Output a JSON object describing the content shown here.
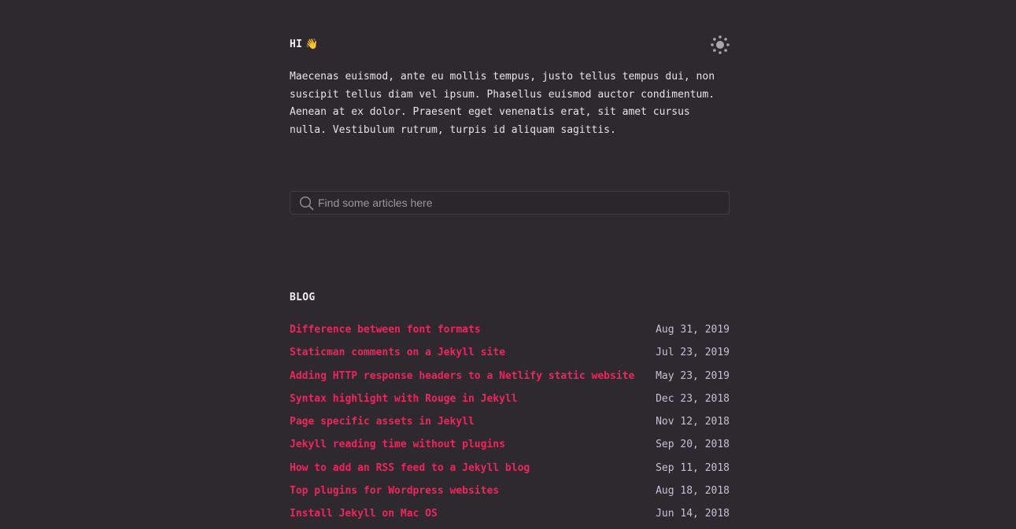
{
  "header": {
    "greeting": "HI",
    "wave_emoji": "👋",
    "theme_toggle_icon": "sun-icon"
  },
  "intro": {
    "text": "Maecenas euismod, ante eu mollis tempus, justo tellus tempus dui, non suscipit tellus diam vel ipsum. Phasellus euismod auctor condimentum. Aenean at ex dolor. Praesent eget venenatis erat, sit amet cursus nulla. Vestibulum rutrum, turpis id aliquam sagittis."
  },
  "search": {
    "placeholder": "Find some articles here",
    "value": "",
    "icon": "search-icon"
  },
  "blog": {
    "title": "BLOG",
    "posts": [
      {
        "title": "Difference between font formats",
        "date": "Aug 31, 2019"
      },
      {
        "title": "Staticman comments on a Jekyll site",
        "date": "Jul 23, 2019"
      },
      {
        "title": "Adding HTTP response headers to a Netlify static website",
        "date": "May 23, 2019"
      },
      {
        "title": "Syntax highlight with Rouge in Jekyll",
        "date": "Dec 23, 2018"
      },
      {
        "title": "Page specific assets in Jekyll",
        "date": "Nov 12, 2018"
      },
      {
        "title": "Jekyll reading time without plugins",
        "date": "Sep 20, 2018"
      },
      {
        "title": "How to add an RSS feed to a Jekyll blog",
        "date": "Sep 11, 2018"
      },
      {
        "title": "Top plugins for Wordpress websites",
        "date": "Aug 18, 2018"
      },
      {
        "title": "Install Jekyll on Mac OS",
        "date": "Jun 14, 2018"
      }
    ]
  },
  "colors": {
    "background": "#2d292e",
    "accent_link": "#f0245c",
    "date_text": "#c9c0d6",
    "body_text": "#e6e4e8"
  }
}
